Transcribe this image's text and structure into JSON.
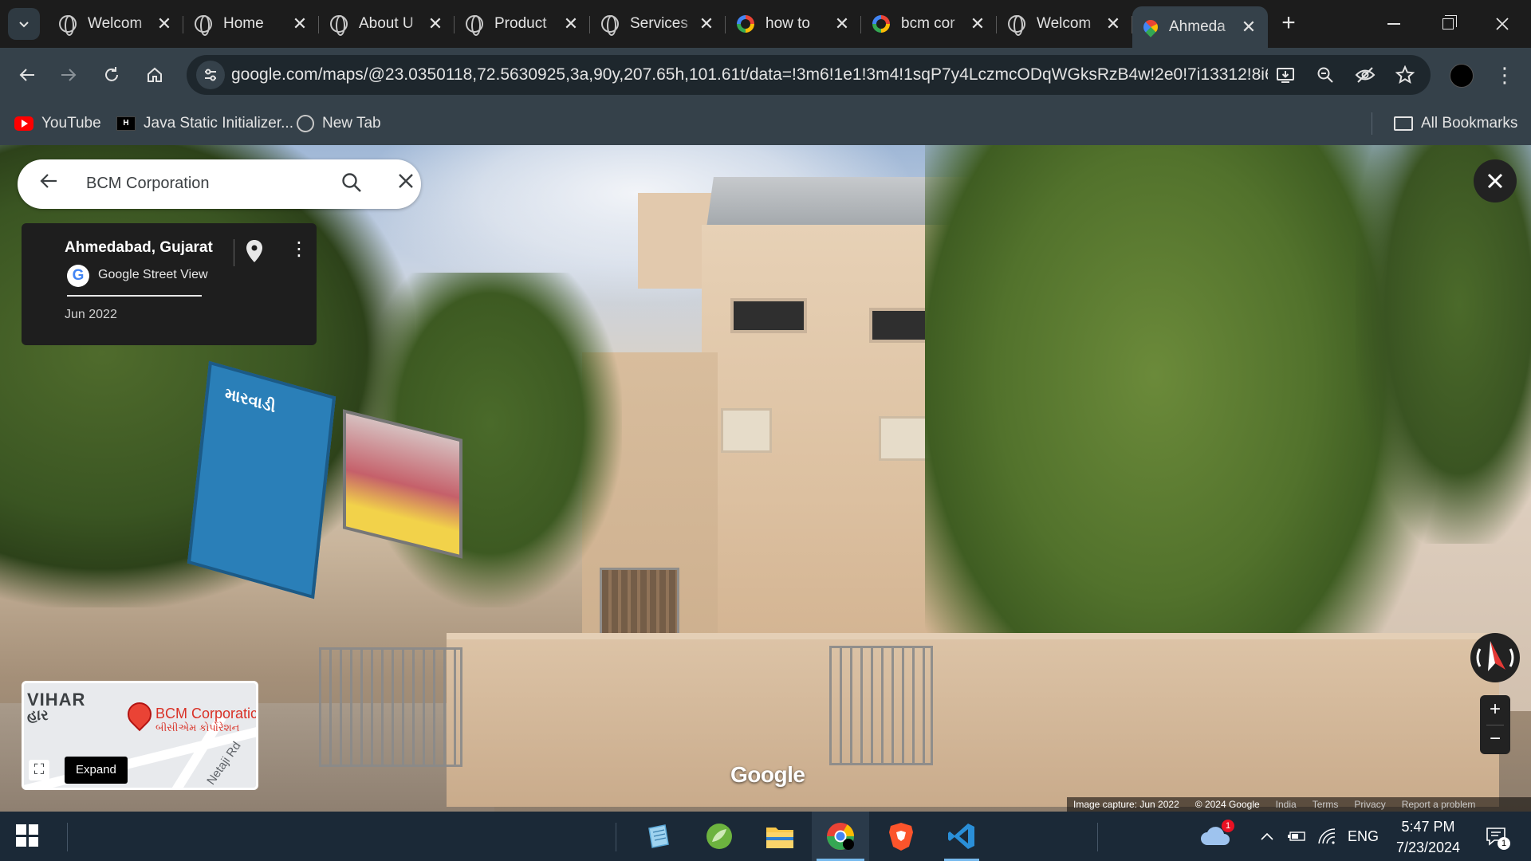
{
  "browser": {
    "tabs": [
      {
        "title": "Welcom",
        "favicon": "globe-icon",
        "active": false
      },
      {
        "title": "Home",
        "favicon": "globe-icon",
        "active": false
      },
      {
        "title": "About U",
        "favicon": "globe-icon",
        "active": false
      },
      {
        "title": "Product",
        "favicon": "globe-icon",
        "active": false
      },
      {
        "title": "Services",
        "favicon": "globe-icon",
        "active": false
      },
      {
        "title": "how to",
        "favicon": "google-icon",
        "active": false
      },
      {
        "title": "bcm cor",
        "favicon": "google-icon",
        "active": false
      },
      {
        "title": "Welcom",
        "favicon": "globe-icon",
        "active": false
      },
      {
        "title": "Ahmeda",
        "favicon": "google-maps-icon",
        "active": true
      }
    ],
    "tab_close_glyph": "✕",
    "new_tab_glyph": "+",
    "url": "google.com/maps/@23.0350118,72.5630925,3a,90y,207.65h,101.61t/data=!3m6!1e1!3m4!1sqP7y4LczmcODqWGksRzB4w!2e0!7i13312!8i66...",
    "bookmarks": [
      {
        "label": "YouTube",
        "icon": "youtube-icon"
      },
      {
        "label": "Java Static Initializer...",
        "icon": "hackerrank-icon"
      },
      {
        "label": "New Tab",
        "icon": "globe-icon"
      }
    ],
    "all_bookmarks": "All Bookmarks"
  },
  "maps": {
    "search": {
      "query": "BCM Corporation"
    },
    "info_card": {
      "place": "Ahmedabad, Gujarat",
      "source": "Google Street View",
      "date": "Jun 2022"
    },
    "minimap": {
      "area_label": "VIHAR",
      "area_label_gujarati": "હાર",
      "business_name": "BCM Corporatic",
      "business_name_gujarati": "બીસીએમ કોર્પોરેશન",
      "road_label": "Netaji Rd",
      "expand_label": "Expand"
    },
    "logo": "Google",
    "footer": {
      "capture": "Image capture: Jun 2022",
      "copyright": "© 2024 Google",
      "region": "India",
      "terms": "Terms",
      "privacy": "Privacy",
      "report": "Report a problem"
    },
    "scene_signs": {
      "blue_sign": "મારવાડી"
    },
    "zoom_in": "+",
    "zoom_out": "−"
  },
  "taskbar": {
    "apps": [
      {
        "name": "notepad-like-app",
        "color": "#9fd3f0"
      },
      {
        "name": "spring-tool-suite",
        "color": "#6db33f"
      },
      {
        "name": "file-explorer",
        "color": "#f8c74a"
      },
      {
        "name": "chrome",
        "color": "#ea4335"
      },
      {
        "name": "brave",
        "color": "#fb542b"
      },
      {
        "name": "vs-code",
        "color": "#2a8fd8"
      }
    ],
    "weather_badge": "1",
    "language": "ENG",
    "time": "5:47 PM",
    "date": "7/23/2024",
    "notification_count": "1"
  }
}
